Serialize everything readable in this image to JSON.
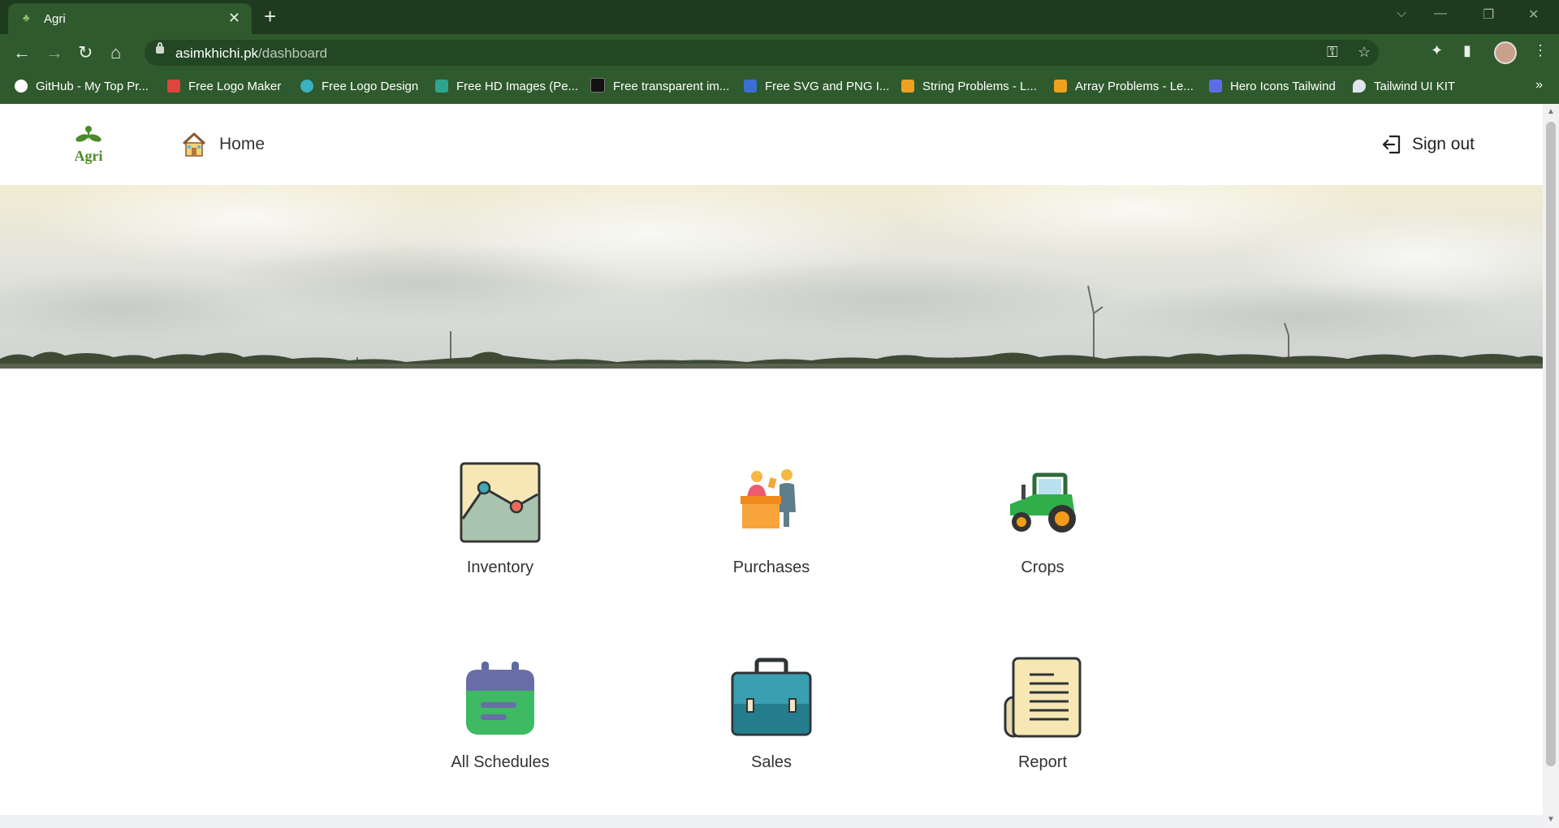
{
  "browser": {
    "tab_title": "Agri",
    "url_host": "asimkhichi.pk",
    "url_path": "/dashboard",
    "bookmarks": [
      {
        "label": "GitHub - My Top Pr...",
        "icon": "github-icon",
        "color": "#ffffff"
      },
      {
        "label": "Free Logo Maker",
        "icon": "logo-maker-icon",
        "color": "#e0443c"
      },
      {
        "label": "Free Logo Design",
        "icon": "logo-design-icon",
        "color": "#3ab0c0"
      },
      {
        "label": "Free HD Images (Pe...",
        "icon": "pexels-icon",
        "color": "#2fa58f"
      },
      {
        "label": "Free transparent im...",
        "icon": "png-icon",
        "color": "#222222"
      },
      {
        "label": "Free SVG and PNG I...",
        "icon": "svg-png-icon",
        "color": "#3b6fd6"
      },
      {
        "label": "String Problems - L...",
        "icon": "leetcode-icon",
        "color": "#f0a020"
      },
      {
        "label": "Array Problems - Le...",
        "icon": "leetcode-icon",
        "color": "#f0a020"
      },
      {
        "label": "Hero Icons Tailwind",
        "icon": "flag-icon",
        "color": "#5b6ee8"
      },
      {
        "label": "Tailwind UI KIT",
        "icon": "rocket-icon",
        "color": "#e5e5e5"
      }
    ],
    "more_label": "»"
  },
  "navbar": {
    "logo_text": "Agri",
    "home_label": "Home",
    "signout_label": "Sign out"
  },
  "dashboard": {
    "cards": [
      {
        "label": "Inventory",
        "icon": "inventory-chart-icon"
      },
      {
        "label": "Purchases",
        "icon": "purchases-icon"
      },
      {
        "label": "Crops",
        "icon": "tractor-icon"
      },
      {
        "label": "All Schedules",
        "icon": "calendar-icon"
      },
      {
        "label": "Sales",
        "icon": "briefcase-icon"
      },
      {
        "label": "Report",
        "icon": "report-scroll-icon"
      }
    ]
  },
  "colors": {
    "chrome_dark": "#1e3a1f",
    "chrome": "#2f5a2d",
    "brand_green": "#4a8a2a"
  }
}
